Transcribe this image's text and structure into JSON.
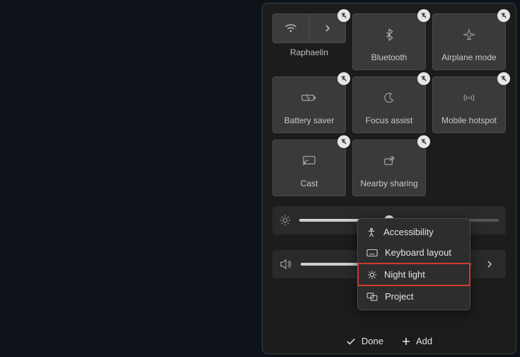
{
  "tiles": [
    {
      "label": "Raphaelin"
    },
    {
      "label": "Bluetooth"
    },
    {
      "label": "Airplane mode"
    },
    {
      "label": "Battery saver"
    },
    {
      "label": "Focus assist"
    },
    {
      "label": "Mobile hotspot"
    },
    {
      "label": "Cast"
    },
    {
      "label": "Nearby sharing"
    }
  ],
  "menu": {
    "items": [
      {
        "label": "Accessibility"
      },
      {
        "label": "Keyboard layout"
      },
      {
        "label": "Night light"
      },
      {
        "label": "Project"
      }
    ]
  },
  "footer": {
    "done": "Done",
    "add": "Add"
  }
}
